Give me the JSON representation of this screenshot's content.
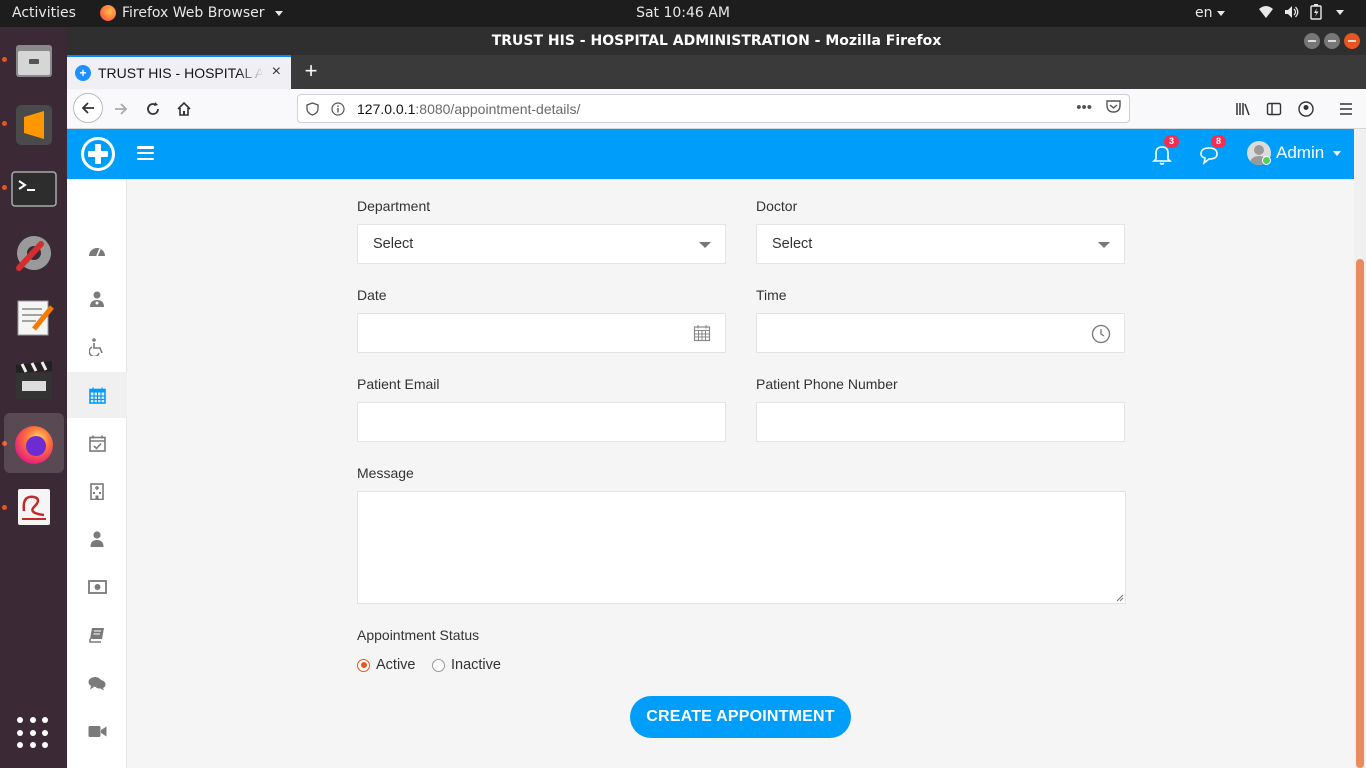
{
  "topbar": {
    "activities": "Activities",
    "app_menu": "Firefox Web Browser",
    "clock": "Sat 10:46 AM",
    "language": "en"
  },
  "dock": {
    "items": [
      "files-icon",
      "sublime-text-icon",
      "terminal-icon",
      "settings-icon",
      "text-editor-icon",
      "video-editor-icon",
      "firefox-icon",
      "document-viewer-icon"
    ],
    "show_apps": "show-applications-icon"
  },
  "browser": {
    "window_title": "TRUST HIS - HOSPITAL ADMINISTRATION - Mozilla Firefox",
    "tab_title": "TRUST HIS - HOSPITAL ADMINISTRATION",
    "url_host": "127.0.0.1",
    "url_port_path": ":8080/appointment-details/",
    "new_tab": "+",
    "tab_close": "×"
  },
  "header": {
    "notifications_count": "3",
    "messages_count": "8",
    "user_name": "Admin"
  },
  "sidebar": {
    "items": [
      "dashboard-icon",
      "doctor-icon",
      "patient-icon",
      "appointments-icon",
      "schedule-icon",
      "departments-icon",
      "employees-icon",
      "accounts-icon",
      "reports-icon",
      "chat-icon",
      "video-call-icon"
    ],
    "active_index": 3
  },
  "form": {
    "department_label": "Department",
    "department_value": "Select",
    "doctor_label": "Doctor",
    "doctor_value": "Select",
    "date_label": "Date",
    "time_label": "Time",
    "email_label": "Patient Email",
    "phone_label": "Patient Phone Number",
    "message_label": "Message",
    "status_label": "Appointment Status",
    "status_active": "Active",
    "status_inactive": "Inactive",
    "status_selected": "Active",
    "submit_label": "CREATE APPOINTMENT"
  },
  "colors": {
    "brand": "#009efb",
    "badge": "#f62d51",
    "radio_accent": "#e95420"
  }
}
